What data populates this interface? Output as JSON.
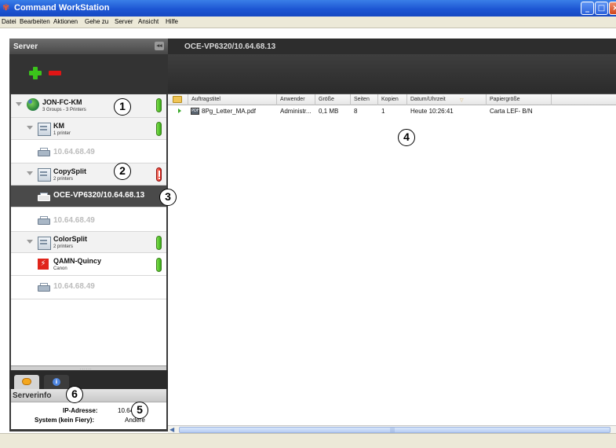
{
  "window": {
    "title": "Command WorkStation"
  },
  "menu": [
    "Datei",
    "Bearbeiten",
    "Aktionen",
    "Gehe zu",
    "Server",
    "Ansicht",
    "Hilfe"
  ],
  "left_panel": {
    "header": "Server",
    "collapse_icon": "double-chevron-left",
    "add_icon": "plus-icon",
    "remove_icon": "minus-icon"
  },
  "tree": {
    "root": {
      "name": "JON-FC-KM",
      "sub": "3 Groups - 3 Printers",
      "status": "ok"
    },
    "groups": [
      {
        "name": "KM",
        "sub": "1 printer",
        "status": "ok",
        "printers": [
          "10.64.68.49"
        ]
      },
      {
        "name": "CopySplit",
        "sub": "2 printers",
        "status": "error",
        "printers": [
          "OCE-VP6320/10.64.68.13",
          "10.64.68.49"
        ]
      },
      {
        "name": "ColorSplit",
        "sub": "2 printers",
        "status": "ok",
        "devices": [
          {
            "name": "QAMN-Quincy",
            "sub": "Canon",
            "status": "ok"
          }
        ],
        "printers": [
          "10.64.68.49"
        ]
      }
    ]
  },
  "tabs": {
    "chat_icon": "chat-bubble-icon",
    "info_icon": "info-icon"
  },
  "server_info": {
    "header": "Serverinfo",
    "ip_label": "IP-Adresse:",
    "ip_value": "10.64.",
    "system_label": "System (kein Fiery):",
    "system_value": "Andere"
  },
  "right_panel": {
    "header": "OCE-VP6320/10.64.68.13",
    "columns": [
      "Auftragstitel",
      "Anwender",
      "Größe",
      "Seiten",
      "Kopien",
      "Datum/Uhrzeit",
      "Papiergröße"
    ],
    "jobs": [
      {
        "title": "8Pg_Letter_MA.pdf",
        "user": "Administr...",
        "size": "0,1 MB",
        "pages": "8",
        "copies": "1",
        "datetime": "Heute 10:26:41",
        "paper": "Carta LEF- B/N"
      }
    ]
  },
  "callouts": [
    "1",
    "2",
    "3",
    "4",
    "5",
    "6"
  ],
  "colors": {
    "title_bar": "#1d56d3",
    "panel_dark": "#3a3a3a",
    "status_ok": "#37a817",
    "status_error": "#d41a10"
  }
}
